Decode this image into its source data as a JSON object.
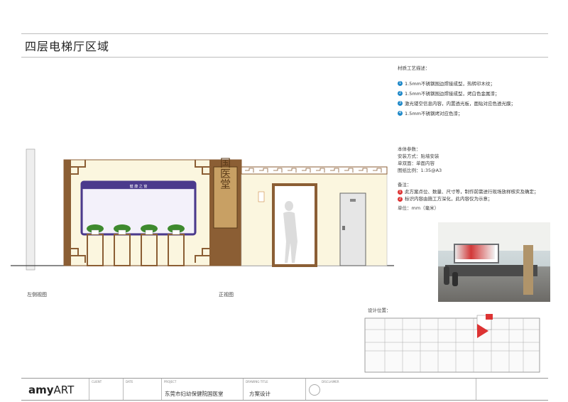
{
  "page_title": "四层电梯厅区域",
  "materials": {
    "heading": "材质工艺描述：",
    "items": [
      {
        "num": "1",
        "text": "1.5mm不锈钢围边焊接成型，热转印木纹；"
      },
      {
        "num": "2",
        "text": "1.5mm不锈钢围边焊接成型，烤白色金属漆；"
      },
      {
        "num": "3",
        "text": "激光镂空信息内容，内置透光板，面贴对应色透光膜；"
      },
      {
        "num": "4",
        "text": "1.5mm不锈钢烤对应色漆；"
      }
    ]
  },
  "params": {
    "heading": "本体参数：",
    "lines": [
      "安装方式：贴墙安装",
      "单双面：单面内容",
      "图纸比例：1:35@A3"
    ]
  },
  "notes": {
    "heading": "备注：",
    "items": [
      {
        "num": "1",
        "text": "此方案点位、数量、尺寸等，制作前需进行现场放样核实及确定；"
      },
      {
        "num": "2",
        "text": "标识内容由施工方深化，此内容仅为示意；"
      }
    ],
    "unit": "单位：mm（毫米）"
  },
  "views": {
    "left": "左侧视图",
    "front": "正视图"
  },
  "board_text": "健 康 之 窗",
  "sign_text": "国医堂",
  "layout_label": "设计位置：",
  "footer": {
    "logo_a": "amy",
    "logo_b": "ART",
    "client_tag": "CLIENT",
    "date_tag": "DATE",
    "project_tag": "PROJECT",
    "project": "东莞市妇幼保健院国医堂",
    "drawing_tag": "DRAWING TITLE",
    "drawing": "方案设计",
    "disclaimer_tag": "DISCLAIMER"
  },
  "colors": {
    "wood": "#8b5e34",
    "board_purple": "#4b3a8c",
    "wall": "#fbf6df",
    "plant": "#3e8a2e",
    "accent": "#1e88c8",
    "note_red": "#dd3333"
  }
}
